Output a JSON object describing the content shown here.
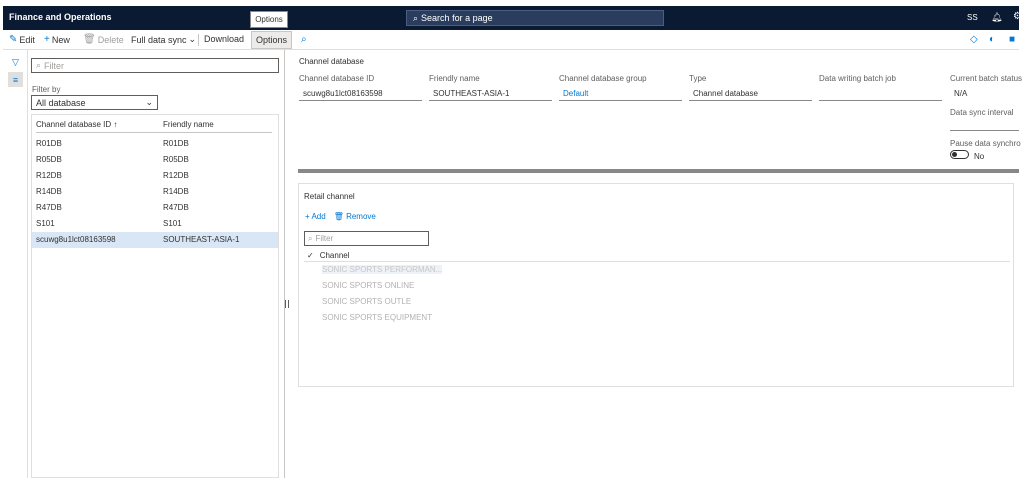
{
  "topbar": {
    "app_title": "Finance and Operations",
    "search_placeholder": "Search for a page",
    "user_initials": "SS"
  },
  "actionbar": {
    "edit": "Edit",
    "new": "New",
    "delete": "Delete",
    "full_data_sync": "Full data sync",
    "download": "Download",
    "options": "Options",
    "tooltip": "Options"
  },
  "list": {
    "filter_placeholder": "Filter",
    "filter_by_label": "Filter by",
    "filter_by_value": "All database",
    "columns": [
      "Channel database ID",
      "Friendly name"
    ],
    "rows": [
      {
        "id": "R01DB",
        "name": "R01DB"
      },
      {
        "id": "R05DB",
        "name": "R05DB"
      },
      {
        "id": "R12DB",
        "name": "R12DB"
      },
      {
        "id": "R14DB",
        "name": "R14DB"
      },
      {
        "id": "R47DB",
        "name": "R47DB"
      },
      {
        "id": "S101",
        "name": "S101"
      },
      {
        "id": "scuwg8u1lct08163598",
        "name": "SOUTHEAST-ASIA-1"
      }
    ]
  },
  "detail": {
    "section_title": "Channel database",
    "fields": [
      {
        "label": "Channel database ID",
        "value": "scuwg8u1lct08163598"
      },
      {
        "label": "Friendly name",
        "value": "SOUTHEAST-ASIA-1"
      },
      {
        "label": "Channel database group",
        "value": "Default"
      },
      {
        "label": "Type",
        "value": "Channel database"
      },
      {
        "label": "Data writing batch job",
        "value": ""
      },
      {
        "label": "Current batch status",
        "value": "N/A"
      }
    ],
    "data_sync_interval_label": "Data sync interval",
    "pause_label": "Pause data synchro",
    "pause_value": "No"
  },
  "retail_channel": {
    "title": "Retail channel",
    "add": "Add",
    "remove": "Remove",
    "filter_placeholder": "Filter",
    "column": "Channel",
    "rows": [
      "SONIC SPORTS PERFORMAN...",
      "SONIC SPORTS ONLINE",
      "SONIC SPORTS OUTLE",
      "SONIC SPORTS EQUIPMENT"
    ]
  }
}
